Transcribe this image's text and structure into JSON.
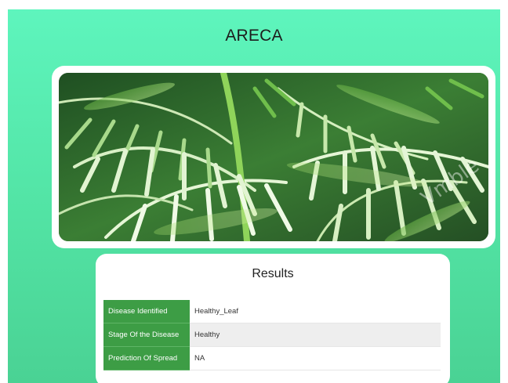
{
  "page": {
    "title": "ARECA"
  },
  "image": {
    "description_icon": "palm-photo",
    "watermark": "Vmble"
  },
  "results": {
    "title": "Results",
    "rows": [
      {
        "label": "Disease Identified",
        "value": "Healthy_Leaf"
      },
      {
        "label": "Stage Of the Disease",
        "value": "Healthy"
      },
      {
        "label": "Prediction Of Spread",
        "value": "NA"
      }
    ]
  },
  "colors": {
    "background_top": "#5ef5bd",
    "background_bottom": "#4ad294",
    "label_cell": "#3d9d45",
    "card": "#ffffff"
  }
}
